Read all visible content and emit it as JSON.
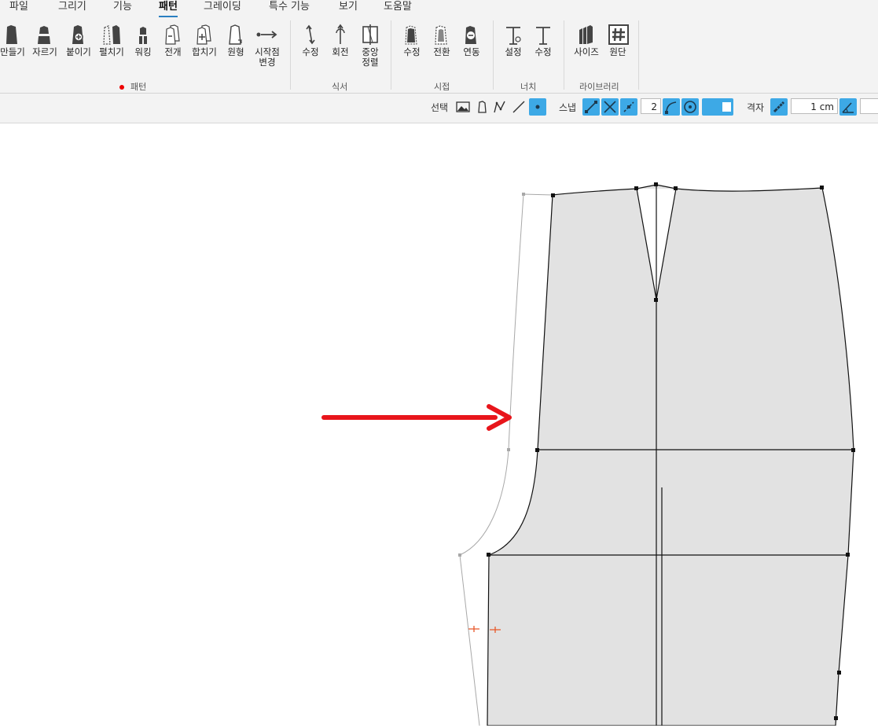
{
  "menu": {
    "items": [
      {
        "label": "파일"
      },
      {
        "label": "그리기"
      },
      {
        "label": "기능"
      },
      {
        "label": "패턴"
      },
      {
        "label": "그레이딩"
      },
      {
        "label": "특수 기능"
      },
      {
        "label": "보기"
      },
      {
        "label": "도움말"
      }
    ],
    "active": "패턴"
  },
  "ribbon": {
    "groups": [
      {
        "label": "패턴",
        "tools": [
          "만들기",
          "자르기",
          "붙이기",
          "펼치기",
          "워킹",
          "전개",
          "합치기",
          "원형",
          "시작점\n변경"
        ]
      },
      {
        "label": "식서",
        "tools": [
          "수정",
          "회전",
          "중앙\n정렬"
        ]
      },
      {
        "label": "시접",
        "tools": [
          "수정",
          "전환",
          "연동"
        ]
      },
      {
        "label": "너치",
        "tools": [
          "설정",
          "수정"
        ]
      },
      {
        "label": "라이브러리",
        "tools": [
          "사이즈",
          "원단"
        ]
      }
    ]
  },
  "options": {
    "select_label": "선택",
    "snap_label": "스냅",
    "snap_value": "2",
    "grid_label": "격자",
    "grid_value": "1 cm"
  },
  "colors": {
    "accent": "#3da9e6",
    "arrow": "#e8151b",
    "pattern_fill": "#e2e2e2",
    "notch": "#e8582a",
    "active_tab_underline": "#2a7fc1"
  }
}
